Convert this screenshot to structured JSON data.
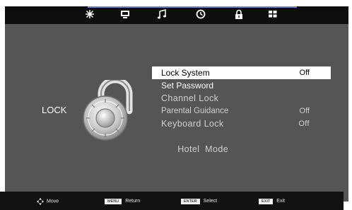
{
  "tabs": [
    {
      "icon": "picture-settings-icon"
    },
    {
      "icon": "screen-icon"
    },
    {
      "icon": "music-note-icon"
    },
    {
      "icon": "clock-icon"
    },
    {
      "icon": "lock-icon"
    },
    {
      "icon": "grid-icon"
    }
  ],
  "page_title": "LOCK",
  "menu": [
    {
      "label": "Lock System",
      "value": "Off"
    },
    {
      "label": "Set Password",
      "value": ""
    },
    {
      "label": "Channel Lock",
      "value": ""
    },
    {
      "label": "Parental Guidance",
      "value": "Off"
    },
    {
      "label": "Keyboard Lock",
      "value": "Off"
    },
    {
      "label": "Hotel  Mode",
      "value": ""
    }
  ],
  "footer": {
    "move": "Move",
    "menu_key": "MENU",
    "menu_label": "Return",
    "enter_key": "ENTER",
    "enter_label": "Select",
    "exit_key": "EXIT",
    "exit_label": "Exit"
  }
}
